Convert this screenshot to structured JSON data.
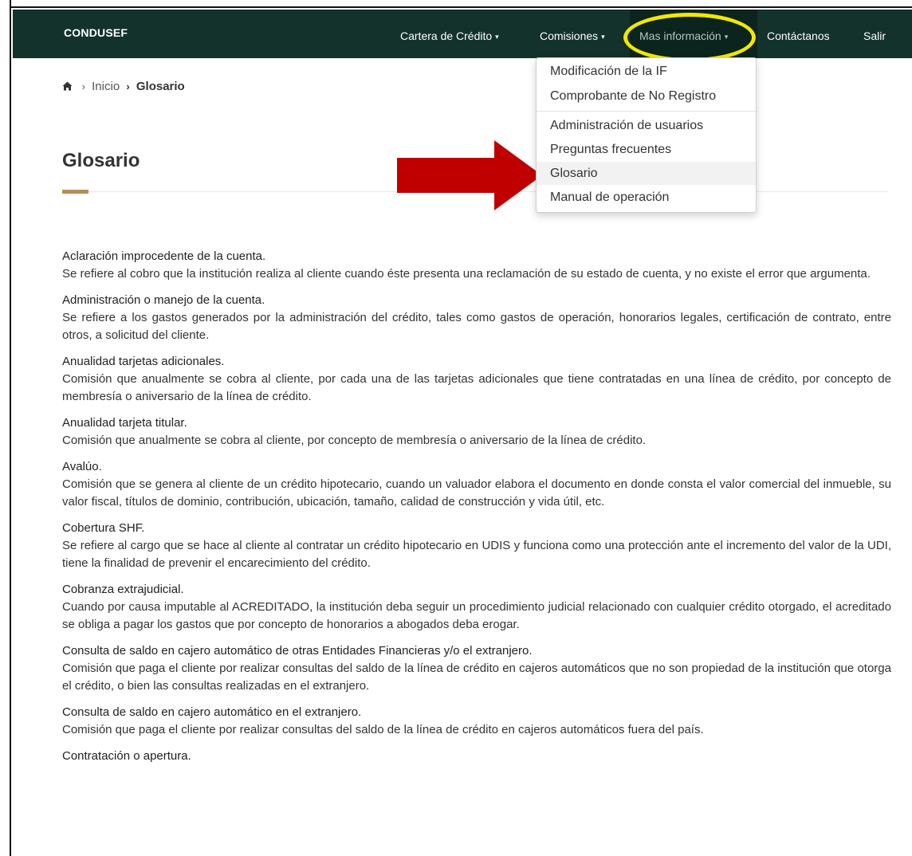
{
  "navbar": {
    "brand": "CONDUSEF",
    "items": [
      {
        "label": "Cartera de Crédito",
        "caret": "▾"
      },
      {
        "label": "Comisiones",
        "caret": "▾"
      },
      {
        "label": "Mas información",
        "caret": "▾"
      },
      {
        "label": "Contáctanos"
      },
      {
        "label": "Salir"
      }
    ],
    "color": "#13322b"
  },
  "dropdown": {
    "items": [
      {
        "label": "Modificación de la IF"
      },
      {
        "label": "Comprobante de No Registro"
      },
      {
        "label": "Administración de usuarios"
      },
      {
        "label": "Preguntas frecuentes"
      },
      {
        "label": "Glosario",
        "active": true
      },
      {
        "label": "Manual de operación"
      }
    ]
  },
  "breadcrumb": {
    "home_icon": "home-icon",
    "separator": "›",
    "inicio": "Inicio",
    "current": "Glosario"
  },
  "page": {
    "title": "Glosario",
    "accent_color": "#b38e5d"
  },
  "glossary": [
    {
      "term": "Aclaración improcedente de la cuenta.",
      "definition": "Se refiere al cobro que la institución realiza al cliente cuando éste presenta una reclamación de su estado de cuenta, y no existe el error que argumenta."
    },
    {
      "term": "Administración o manejo de la cuenta.",
      "definition": "Se refiere a los gastos generados por la administración del crédito, tales como gastos de operación, honorarios legales, certificación de contrato, entre otros, a solicitud del cliente."
    },
    {
      "term": "Anualidad tarjetas adicionales.",
      "definition": "Comisión que anualmente se cobra al cliente, por cada una de las tarjetas adicionales que tiene contratadas en una línea de crédito, por concepto de membresía o aniversario de la línea de crédito."
    },
    {
      "term": "Anualidad tarjeta titular.",
      "definition": "Comisión que anualmente se cobra al cliente, por concepto de membresía o aniversario de la línea de crédito."
    },
    {
      "term": "Avalúo.",
      "definition": "Comisión que se genera al cliente de un crédito hipotecario, cuando un valuador elabora el documento en donde consta el valor comercial del inmueble, su valor fiscal, títulos de dominio, contribución, ubicación, tamaño, calidad de construcción y vida útil, etc."
    },
    {
      "term": "Cobertura SHF.",
      "definition": "Se refiere al cargo que se hace al cliente al contratar un crédito hipotecario en UDIS y funciona como una protección ante el incremento del valor de la UDI, tiene la finalidad de prevenir el encarecimiento del crédito."
    },
    {
      "term": "Cobranza extrajudicial.",
      "definition": "Cuando por causa imputable al ACREDITADO, la institución deba seguir un procedimiento judicial relacionado con cualquier crédito otorgado, el acreditado se obliga a pagar los gastos que por concepto de honorarios a abogados deba erogar."
    },
    {
      "term": "Consulta de saldo en cajero automático de otras Entidades Financieras y/o el extranjero.",
      "definition": "Comisión que paga el cliente por realizar consultas del saldo de la línea de crédito en cajeros automáticos que no son propiedad de la institución que otorga el crédito, o bien las consultas realizadas en el extranjero."
    },
    {
      "term": "Consulta de saldo en cajero automático en el extranjero.",
      "definition": "Comisión que paga el cliente por realizar consultas del saldo de la línea de crédito en cajeros automáticos fuera del país."
    },
    {
      "term": "Contratación o apertura.",
      "definition": ""
    }
  ],
  "annotations": {
    "ring_color": "#f2e800",
    "arrow_color": "#c00000"
  }
}
